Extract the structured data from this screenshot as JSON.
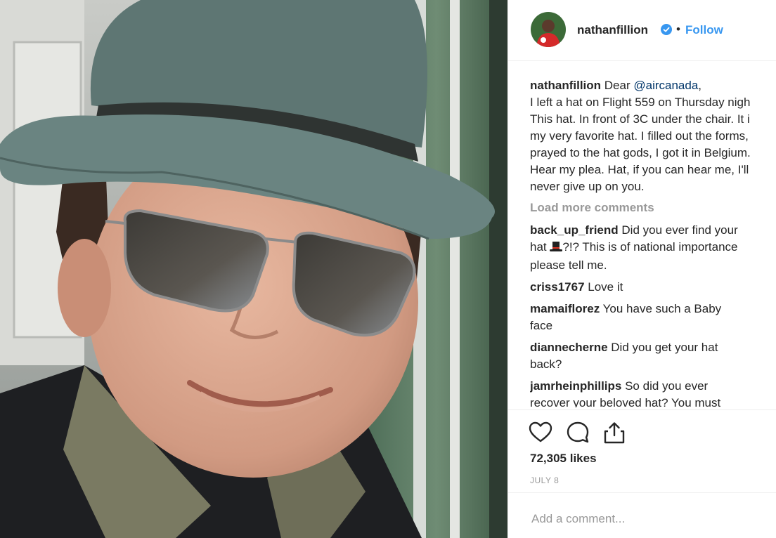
{
  "post": {
    "username": "nathanfillion",
    "verified_icon": "verified-badge-icon",
    "separator": "•",
    "follow_label": "Follow",
    "caption_lines": [
      {
        "mention_prefix": "Dear ",
        "mention": "@aircanada",
        "mention_suffix": ","
      },
      "I left a hat on Flight 559 on Thursday nigh",
      "This hat. In front of 3C under the chair. It i",
      "my very favorite hat. I filled out the forms,",
      "prayed to the hat gods, I got it in Belgium.",
      "Hear my plea. Hat, if you can hear me, I'll",
      "never give up on you."
    ],
    "load_more": "Load more comments",
    "comments": [
      {
        "user": "back_up_friend",
        "text1": "Did you ever find your",
        "line2a": "hat ",
        "emoji": "🎩",
        "line2b": "?!? This is of national importance",
        "line3": "please tell me."
      },
      {
        "user": "criss1767",
        "text": "Love it"
      },
      {
        "user": "mamaiflorez",
        "text": "You have such a Baby",
        "text2": "face"
      },
      {
        "user": "diannecherne",
        "text": "Did you get your hat",
        "text2": "back?"
      },
      {
        "user": "jamrheinphillips",
        "text": "So did you ever",
        "text2": "recover your beloved hat? You must"
      }
    ],
    "likes": "72,305 likes",
    "date": "JULY 8",
    "add_comment_placeholder": "Add a comment...",
    "icons": [
      "heart-icon",
      "comment-icon",
      "share-icon"
    ],
    "colors": {
      "link": "#3897f0",
      "muted": "#999999",
      "text": "#262626"
    }
  }
}
